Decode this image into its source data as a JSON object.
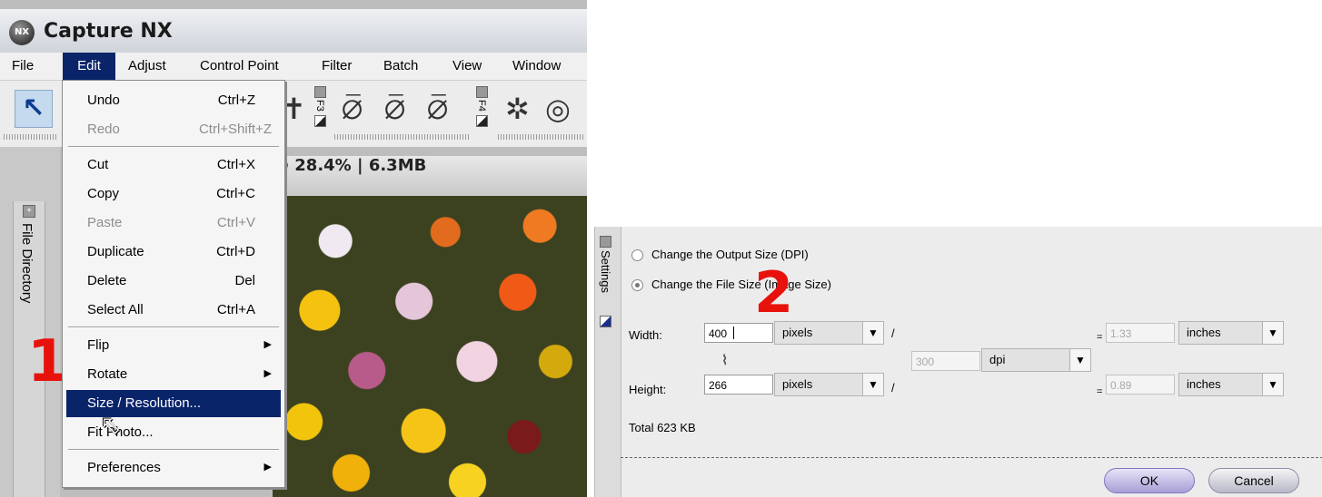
{
  "app": {
    "title": "Capture NX",
    "logo_text": "NX"
  },
  "menubar": [
    {
      "label": "File"
    },
    {
      "label": "Edit"
    },
    {
      "label": "Adjust"
    },
    {
      "label": "Control Point"
    },
    {
      "label": "Filter"
    },
    {
      "label": "Batch"
    },
    {
      "label": "View"
    },
    {
      "label": "Window"
    }
  ],
  "toolbar": {
    "fkeys": [
      "F3",
      "F4"
    ]
  },
  "sidebar": {
    "label": "File Directory",
    "step_marker": "1"
  },
  "image_header": "@ 28.4% | 6.3MB",
  "edit_menu": {
    "items": [
      {
        "label": "Undo",
        "shortcut": "Ctrl+Z"
      },
      {
        "label": "Redo",
        "shortcut": "Ctrl+Shift+Z"
      },
      {
        "label": "Cut",
        "shortcut": "Ctrl+X"
      },
      {
        "label": "Copy",
        "shortcut": "Ctrl+C"
      },
      {
        "label": "Paste",
        "shortcut": "Ctrl+V"
      },
      {
        "label": "Duplicate",
        "shortcut": "Ctrl+D"
      },
      {
        "label": "Delete",
        "shortcut": "Del"
      },
      {
        "label": "Select All",
        "shortcut": "Ctrl+A"
      },
      {
        "label": "Flip",
        "shortcut": ""
      },
      {
        "label": "Rotate",
        "shortcut": ""
      },
      {
        "label": "Size / Resolution...",
        "shortcut": ""
      },
      {
        "label": "Fit Photo...",
        "shortcut": ""
      },
      {
        "label": "Preferences",
        "shortcut": ""
      }
    ]
  },
  "dialog": {
    "panel_label": "Settings",
    "step_marker": "2",
    "radio_output": "Change the Output Size (DPI)",
    "radio_file": "Change the File Size (Image Size)",
    "width_label": "Width:",
    "height_label": "Height:",
    "width_value": "400",
    "height_value": "266",
    "width_unit": "pixels",
    "height_unit": "pixels",
    "resolution_value": "300",
    "resolution_unit": "dpi",
    "width_inches": "1.33",
    "height_inches": "0.89",
    "inches_unit": "inches",
    "slash": "/",
    "equals": "=",
    "total": "Total 623 KB",
    "ok_label": "OK",
    "cancel_label": "Cancel"
  }
}
